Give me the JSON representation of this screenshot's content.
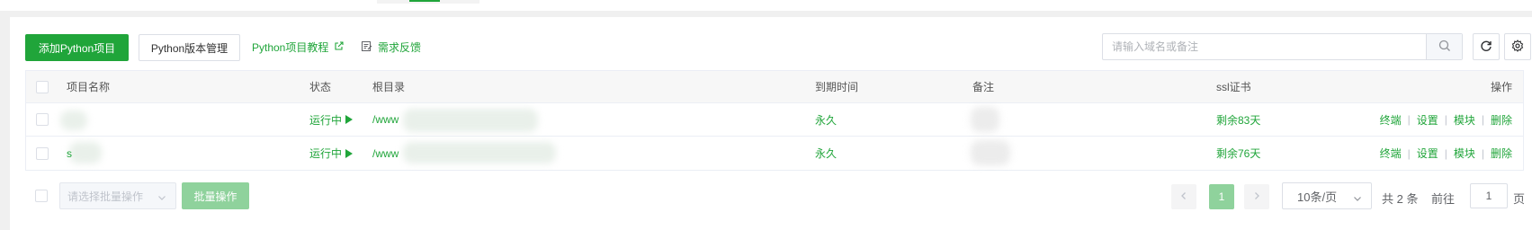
{
  "toolbar": {
    "add_project": "添加Python项目",
    "version_manage": "Python版本管理",
    "tutorial": "Python项目教程",
    "feedback": "需求反馈",
    "search_placeholder": "请输入域名或备注"
  },
  "icons": {
    "external_link": "external-link-icon",
    "feedback": "edit-note-icon",
    "search": "search-icon",
    "refresh": "refresh-icon",
    "settings": "gear-icon"
  },
  "colors": {
    "accent": "#20a53a",
    "accent_disabled": "#8fd29c"
  },
  "table": {
    "headers": {
      "name": "项目名称",
      "status": "状态",
      "root": "根目录",
      "expire": "到期时间",
      "remark": "备注",
      "ssl": "ssl证书",
      "ops": "操作"
    },
    "rows": [
      {
        "name": "",
        "status": "运行中",
        "root": "/www",
        "expire": "永久",
        "remark": "",
        "ssl": "剩余83天",
        "ops": [
          "终端",
          "设置",
          "模块",
          "删除"
        ]
      },
      {
        "name": "s",
        "status": "运行中",
        "root": "/www",
        "expire": "永久",
        "remark": "",
        "ssl": "剩余76天",
        "ops": [
          "终端",
          "设置",
          "模块",
          "删除"
        ]
      }
    ]
  },
  "footer": {
    "batch_placeholder": "请选择批量操作",
    "batch_button": "批量操作",
    "current_page": "1",
    "page_size": "10条/页",
    "total": "共 2 条",
    "goto_label": "前往",
    "goto_value": "1",
    "page_suffix": "页"
  }
}
